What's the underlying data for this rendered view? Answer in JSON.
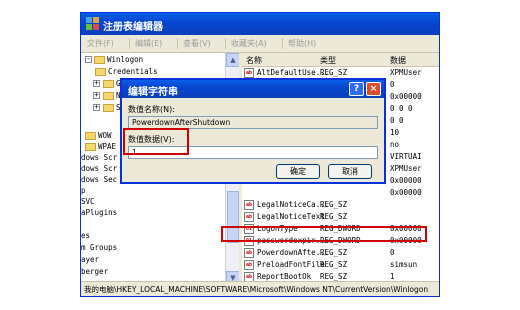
{
  "window": {
    "title": "注册表编辑器",
    "icon": "regedit-icon"
  },
  "menu": [
    "文件(F)",
    "编辑(E)",
    "查看(V)",
    "收藏夹(A)",
    "帮助(H)"
  ],
  "tree": {
    "items": [
      {
        "label": "Winlogon",
        "expander": "-"
      },
      {
        "label": "Credentials",
        "expander": ""
      },
      {
        "label": "G",
        "expander": "+"
      },
      {
        "label": "N",
        "expander": "+"
      },
      {
        "label": "S",
        "expander": "+"
      },
      {
        "label": "WOW",
        "expander": ""
      },
      {
        "label": "WPAE",
        "expander": ""
      },
      {
        "label": "dows Scr",
        "expander": ""
      },
      {
        "label": "dows Scr",
        "expander": ""
      },
      {
        "label": "dows Sec",
        "expander": ""
      },
      {
        "label": "p",
        "expander": ""
      },
      {
        "label": "SVC",
        "expander": ""
      },
      {
        "label": "aPlugins",
        "expander": ""
      },
      {
        "label": "",
        "expander": ""
      },
      {
        "label": "es",
        "expander": ""
      },
      {
        "label": "m Groups",
        "expander": ""
      },
      {
        "label": "ayer",
        "expander": ""
      },
      {
        "label": "berger",
        "expander": ""
      }
    ]
  },
  "list": {
    "columns": [
      "名称",
      "类型",
      "数据"
    ],
    "rows": [
      {
        "name": "AltDefaultUse...",
        "type": "REG_SZ",
        "data": "XPMUser"
      },
      {
        "name": "",
        "type": "",
        "data": "0"
      },
      {
        "name": "",
        "type": "",
        "data": "0x00000"
      },
      {
        "name": "",
        "type": "",
        "data": "0 0 0"
      },
      {
        "name": "",
        "type": "",
        "data": "0 0"
      },
      {
        "name": "",
        "type": "",
        "data": "10"
      },
      {
        "name": "",
        "type": "",
        "data": "no"
      },
      {
        "name": "",
        "type": "",
        "data": "VIRTUAI"
      },
      {
        "name": "",
        "type": "",
        "data": "XPMUser"
      },
      {
        "name": "",
        "type": "",
        "data": "0x00000"
      },
      {
        "name": "",
        "type": "",
        "data": "0x00000"
      },
      {
        "name": "LegalNoticeCa...",
        "type": "REG_SZ",
        "data": ""
      },
      {
        "name": "LegalNoticeText",
        "type": "REG_SZ",
        "data": ""
      },
      {
        "name": "LogonType",
        "type": "REG_DWORD",
        "data": "0x00000"
      },
      {
        "name": "passwordexpir...",
        "type": "REG_DWORD",
        "data": "0x00000"
      },
      {
        "name": "PowerdownAfte...",
        "type": "REG_SZ",
        "data": "0"
      },
      {
        "name": "PreloadFontFile",
        "type": "REG_SZ",
        "data": "simsun"
      },
      {
        "name": "ReportBootOk",
        "type": "REG_SZ",
        "data": "1"
      }
    ]
  },
  "status": "我的电脑\\HKEY_LOCAL_MACHINE\\SOFTWARE\\Microsoft\\Windows NT\\CurrentVersion\\Winlogon",
  "dialog": {
    "title": "编辑字符串",
    "help_icon": "?",
    "close_icon": "×",
    "name_label": "数值名称(N):",
    "name_value": "PowerdownAfterShutdown",
    "data_label": "数值数据(V):",
    "data_value": "1",
    "ok_label": "确定",
    "cancel_label": "取消"
  },
  "colors": {
    "highlight": "#d00000",
    "titlebar": "#0a5fe8",
    "window_bg": "#ece9d8"
  }
}
